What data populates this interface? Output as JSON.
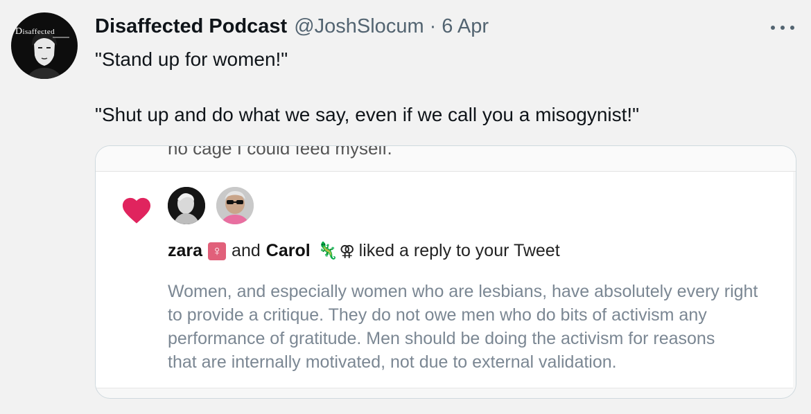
{
  "tweet": {
    "author": {
      "display_name": "Disaffected Podcast",
      "handle": "@JoshSlocum",
      "separator": "·",
      "date": "6 Apr",
      "avatar_wordmark": "Disaffected"
    },
    "more_menu_icon": "more-horizontal-icon",
    "text_lines": [
      "\"Stand up for women!\"",
      "\"Shut up and do what we say, even if we call you a misogynist!\""
    ]
  },
  "media": {
    "cut_off_text": "no cage I could feed myself.",
    "notification": {
      "icon": "heart-icon",
      "icon_color": "#e0245e",
      "user1_name": "zara",
      "user1_badge": "♀",
      "connector": "and",
      "user2_name": "Carol",
      "user2_emoji": "🦎",
      "user2_symbol": "⚢",
      "action_text": "liked a reply to your Tweet",
      "reply_lines": [
        "Women, and especially women who are lesbians, have absolutely every right",
        "to provide a critique. They do not owe men who do bits of activism any",
        "performance of gratitude. Men should be doing the activism for reasons",
        "that are internally motivated, not due to external validation."
      ]
    }
  },
  "colors": {
    "background": "#f2f2f2",
    "heart": "#e0245e",
    "badge": "#e1607a",
    "secondary_text": "#536471"
  }
}
